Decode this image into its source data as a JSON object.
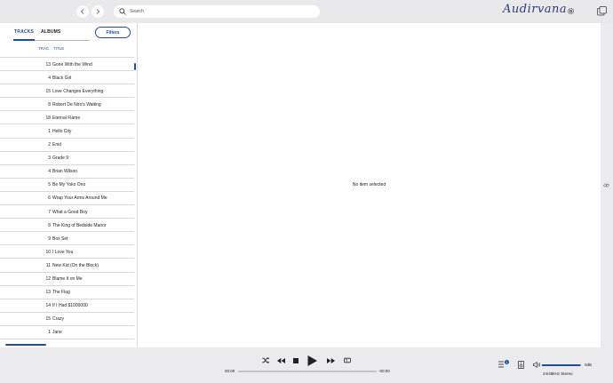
{
  "search": {
    "placeholder": "Search"
  },
  "logo": {
    "text": "Audirvana"
  },
  "tabs": [
    {
      "label": "TRACKS"
    },
    {
      "label": "ALBUMS"
    }
  ],
  "filters_label": "Filters",
  "columns": {
    "track": "TRAC",
    "title": "TITLE"
  },
  "tracks": [
    {
      "num": "13",
      "title": "Gone With the Wind"
    },
    {
      "num": "4",
      "title": "Black Girl"
    },
    {
      "num": "15",
      "title": "Love Changes Everything"
    },
    {
      "num": "8",
      "title": "Robert De Niro's Waiting"
    },
    {
      "num": "18",
      "title": "Eternal Flame"
    },
    {
      "num": "1",
      "title": "Hello City"
    },
    {
      "num": "2",
      "title": "Enid"
    },
    {
      "num": "3",
      "title": "Grade 9"
    },
    {
      "num": "4",
      "title": "Brian Wilson"
    },
    {
      "num": "5",
      "title": "Be My Yoko Ono"
    },
    {
      "num": "6",
      "title": "Wrap Your Arms Around Me"
    },
    {
      "num": "7",
      "title": "What a Good Boy"
    },
    {
      "num": "8",
      "title": "The King of Bedside Manor"
    },
    {
      "num": "9",
      "title": "Box Set"
    },
    {
      "num": "10",
      "title": "I Love You"
    },
    {
      "num": "11",
      "title": "New Kid (On the Block)"
    },
    {
      "num": "12",
      "title": "Blame It on Me"
    },
    {
      "num": "13",
      "title": "The Flag"
    },
    {
      "num": "14",
      "title": "If I Had $1000000"
    },
    {
      "num": "15",
      "title": "Crazy"
    },
    {
      "num": "1",
      "title": "Jane"
    }
  ],
  "detail": {
    "empty_message": "No item selected"
  },
  "player": {
    "elapsed": "00:00",
    "remaining": "-00:00",
    "queue_count": "1",
    "volume_db": "0dB",
    "volume_level": 0.98,
    "format": "24/48kHz Stereo"
  },
  "colors": {
    "accent": "#1c4f9a",
    "logo": "#2d3a7a"
  },
  "icons": [
    "back-icon",
    "forward-icon",
    "search-icon",
    "settings-icon",
    "panel-icon",
    "link-icon",
    "shuffle-icon",
    "rewind-icon",
    "stop-icon",
    "play-icon",
    "fast-forward-icon",
    "repeat-icon",
    "queue-icon",
    "device-icon",
    "volume-icon"
  ]
}
